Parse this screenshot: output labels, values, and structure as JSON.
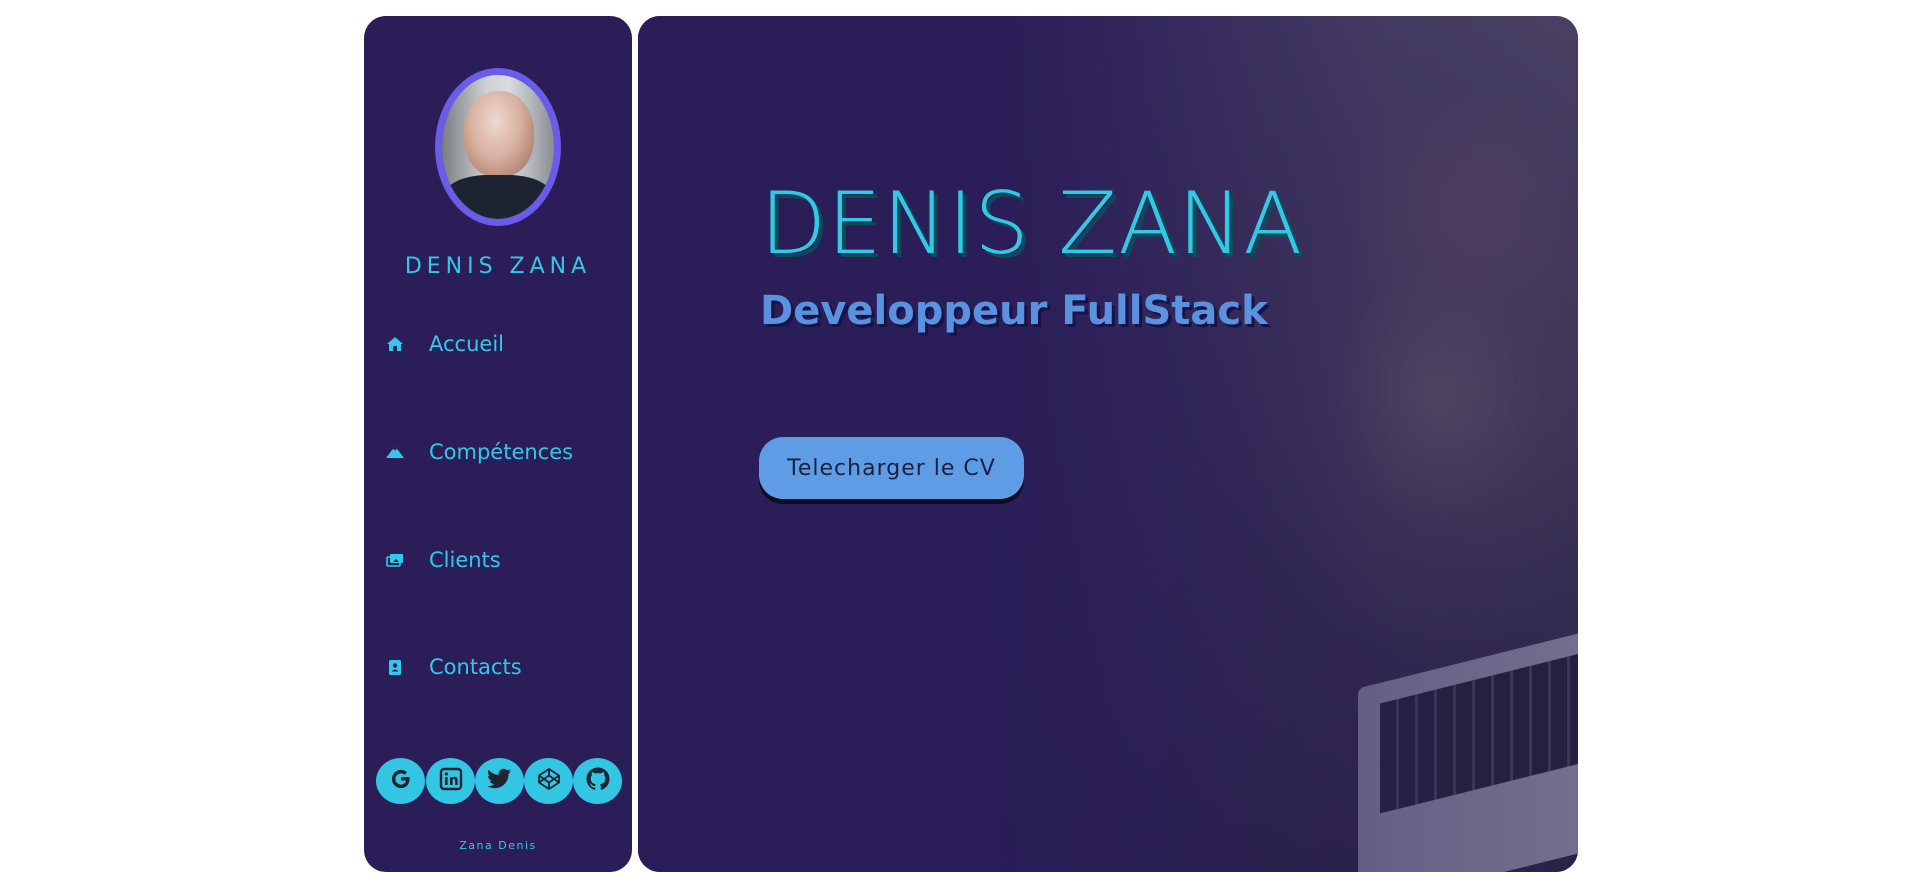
{
  "sidebar": {
    "name": "DENIS ZANA",
    "nav": [
      {
        "label": "Accueil",
        "icon": "home-icon"
      },
      {
        "label": "Compétences",
        "icon": "mountain-icon"
      },
      {
        "label": "Clients",
        "icon": "images-icon"
      },
      {
        "label": "Contacts",
        "icon": "contact-card-icon"
      }
    ],
    "socials": [
      "google-icon",
      "linkedin-icon",
      "twitter-icon",
      "codepen-icon",
      "github-icon"
    ],
    "footer": "Zana Denis"
  },
  "hero": {
    "name": "DENIS ZANA",
    "role": "Developpeur FullStack",
    "cv_button": "Telecharger le CV"
  },
  "colors": {
    "panel": "#2a1d58",
    "accent": "#33c9e6",
    "role": "#5b92e0",
    "button": "#5e9de6"
  }
}
